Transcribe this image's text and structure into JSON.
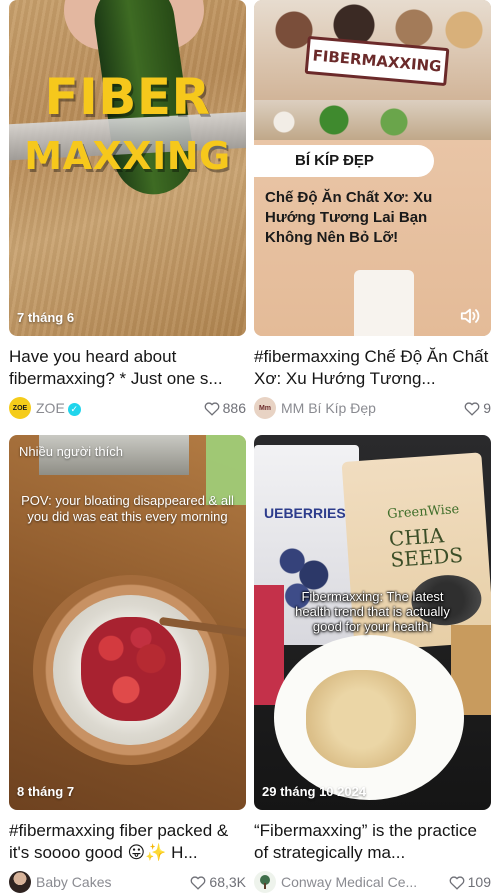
{
  "cards": [
    {
      "thumb_text_1": "FIBER",
      "thumb_text_2": "MAXXING",
      "date": "7 tháng 6",
      "caption": "Have you heard about fibermaxxing? * Just one s...",
      "author": "ZOE",
      "avatar_text": "ZOE",
      "verified": true,
      "likes": "886"
    },
    {
      "sign_text": "FIBERMAXXING",
      "pill_text": "BÍ KÍP ĐẸP",
      "headline": "Chế Độ Ăn Chất Xơ: Xu Hướng Tương Lai Bạn Không Nên Bỏ Lỡ!",
      "caption": "#fibermaxxing Chế Độ Ăn Chất Xơ: Xu Hướng Tương...",
      "author": "MM Bí Kíp Đẹp",
      "avatar_text": "Mm",
      "likes": "9"
    },
    {
      "label": "Nhiều người thích",
      "overlay": "POV: your bloating disappeared & all you did was eat this every morning",
      "date": "8 tháng 7",
      "caption": "#fibermaxxing fiber packed & it's soooo good 😛✨ H...",
      "author": "Baby Cakes",
      "likes": "68,3K"
    },
    {
      "bag1_text": "UEBERRIES",
      "bag2_brand": "GreenWise",
      "bag2_name": "CHIA SEEDS",
      "overlay": "Fibermaxxing: The latest health trend that is actually good for your health!",
      "date": "29 tháng 10 2024",
      "caption": "“Fibermaxxing” is the practice of strategically ma...",
      "author": "Conway Medical Ce...",
      "likes": "109"
    }
  ],
  "colors": {
    "fiber_yellow": "#f6c81c",
    "verified_blue": "#20d5ec",
    "meta_gray": "#8a8b91"
  }
}
